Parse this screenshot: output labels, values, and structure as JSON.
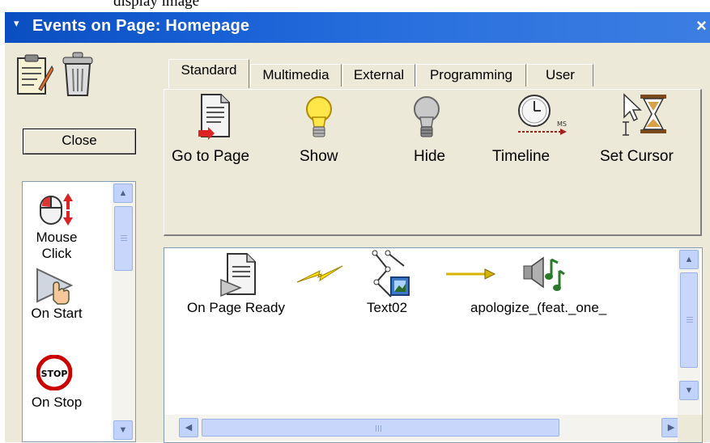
{
  "top_text": "display image",
  "window": {
    "title": "Events on Page: Homepage",
    "collapse_icon": "▾",
    "close_icon": "×"
  },
  "left": {
    "close_label": "Close",
    "triggers": [
      {
        "label1": "Mouse",
        "label2": "Click",
        "icon": "mouse-click-icon"
      },
      {
        "label1": "On Start",
        "icon": "on-start-icon"
      },
      {
        "label1": "On Stop",
        "icon": "stop-sign-icon"
      }
    ]
  },
  "tabs": [
    "Standard",
    "Multimedia",
    "External",
    "Programming",
    "User"
  ],
  "active_tab": "Standard",
  "actions": [
    {
      "label": "Go to Page",
      "icon": "document-arrow-icon"
    },
    {
      "label": "Show",
      "icon": "lit-bulb-icon"
    },
    {
      "label": "Hide",
      "icon": "unlit-bulb-icon"
    },
    {
      "label": "Timeline",
      "icon": "clock-timeline-icon"
    },
    {
      "label": "Set Cursor",
      "icon": "cursor-hourglass-icon"
    }
  ],
  "event_chain": [
    {
      "label": "On Page Ready",
      "icon": "page-ready-icon"
    },
    {
      "label": "",
      "icon": "lightning-icon"
    },
    {
      "label": "Text02",
      "icon": "text-object-icon"
    },
    {
      "label": "",
      "icon": "arrow-right-icon"
    },
    {
      "label": "apologize_(feat._one_",
      "icon": "sound-icon"
    }
  ],
  "scroll": {
    "up": "▲",
    "down": "▼",
    "left": "◀",
    "right": "▶"
  }
}
